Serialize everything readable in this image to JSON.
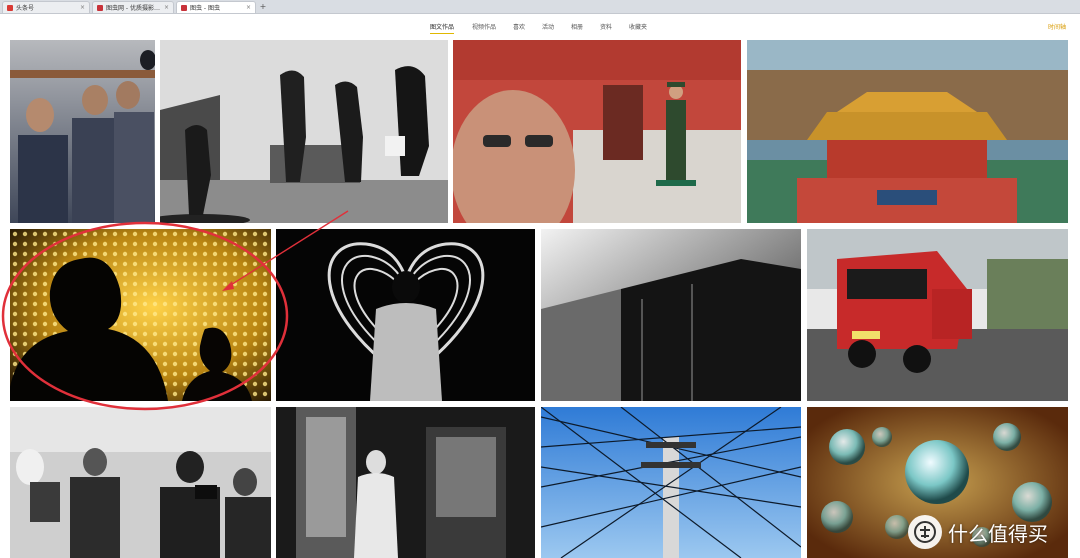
{
  "browser": {
    "tabs": [
      {
        "label": "头条号",
        "favicon_color": "#d93a35",
        "active": false
      },
      {
        "label": "图虫网 - 优质摄影师交流社区",
        "favicon_color": "#c8323a",
        "active": false
      },
      {
        "label": "图虫 - 图虫",
        "favicon_color": "#c8323a",
        "active": true
      }
    ],
    "tab_close_glyph": "×",
    "new_tab_glyph": "+"
  },
  "site_nav": {
    "items": [
      {
        "label": "图文作品",
        "active": true
      },
      {
        "label": "视频作品",
        "active": false
      },
      {
        "label": "喜欢",
        "active": false
      },
      {
        "label": "活动",
        "active": false
      },
      {
        "label": "相册",
        "active": false
      },
      {
        "label": "资料",
        "active": false
      },
      {
        "label": "收藏夹",
        "active": false
      }
    ],
    "right_link": "时间轴",
    "accent_color": "#e0b800"
  },
  "photos": [
    {
      "subject": "crowd of elderly men in dark jackets"
    },
    {
      "subject": "black and white people walking toward Forbidden City gate"
    },
    {
      "subject": "blurred man with sunglasses and honor guard soldier"
    },
    {
      "subject": "aerial view of Forbidden City palace roofs"
    },
    {
      "subject": "silhouettes against golden bokeh lights"
    },
    {
      "subject": "woman in front of glowing heart light sculpture"
    },
    {
      "subject": "black and white abstract architecture"
    },
    {
      "subject": "red tuk-tuk vehicle on street"
    },
    {
      "subject": "photographers in black and white street scene"
    },
    {
      "subject": "black and white person at doorway"
    },
    {
      "subject": "utility pole with tangled wires against blue sky"
    },
    {
      "subject": "colorful glass marbles close-up"
    }
  ],
  "annotation": {
    "color": "#e0303a",
    "shape": "circle-with-arrow"
  },
  "watermark": {
    "text": "什么值得买",
    "icon": "zhi-logo-icon"
  }
}
